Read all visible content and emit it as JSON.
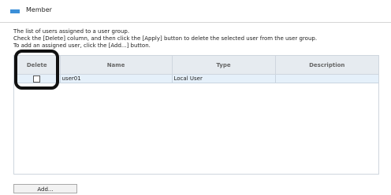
{
  "header": {
    "title": "Member",
    "accent_color": "#3b8fd8"
  },
  "description": {
    "line1": "The list of users assigned to a user group.",
    "line2": "Check the [Delete] column, and then click the [Apply] button to delete the selected user from the user group.",
    "line3": "To add an assigned user, click the [Add...] button."
  },
  "table": {
    "columns": [
      "Delete",
      "Name",
      "Type",
      "Description"
    ],
    "rows": [
      {
        "delete_checked": false,
        "name": "user01",
        "type": "Local User",
        "description": ""
      }
    ]
  },
  "buttons": {
    "add_label": "Add..."
  }
}
